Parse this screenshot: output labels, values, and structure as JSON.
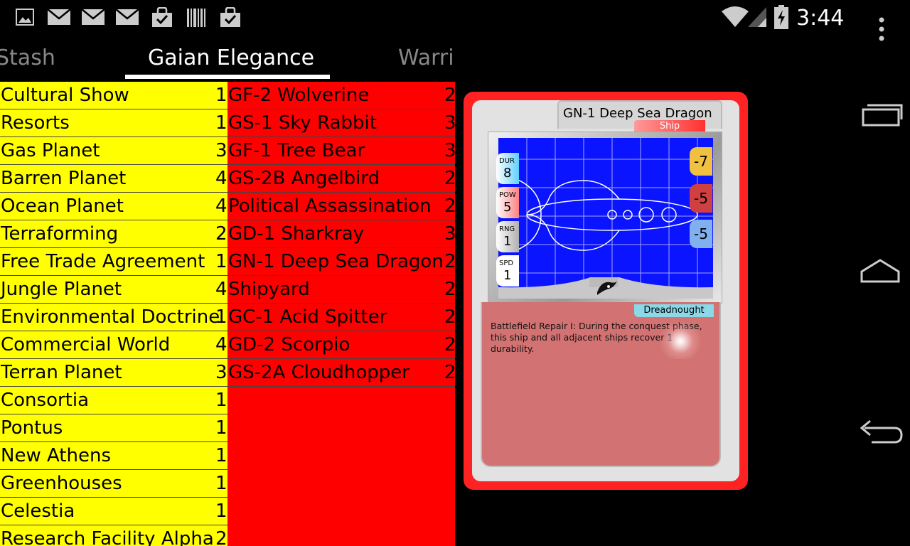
{
  "status_bar": {
    "time": "3:44",
    "notification_icons": [
      "image-icon",
      "mail-icon",
      "mail-icon",
      "mail-icon",
      "shopping-bag-icon",
      "barcode-icon",
      "shopping-bag-icon"
    ],
    "system_icons": [
      "wifi-icon",
      "signal-icon",
      "battery-charging-icon"
    ]
  },
  "tabs": [
    {
      "label": "Stash"
    },
    {
      "label": "Gaian Elegance",
      "selected": true
    },
    {
      "label": "Warrio"
    }
  ],
  "yellow_list": [
    {
      "name": "Cultural Show",
      "qty": "1"
    },
    {
      "name": "Resorts",
      "qty": "1"
    },
    {
      "name": "Gas Planet",
      "qty": "3"
    },
    {
      "name": "Barren Planet",
      "qty": "4"
    },
    {
      "name": "Ocean Planet",
      "qty": "4"
    },
    {
      "name": "Terraforming",
      "qty": "2"
    },
    {
      "name": "Free Trade Agreement",
      "qty": "1"
    },
    {
      "name": "Jungle Planet",
      "qty": "4"
    },
    {
      "name": "Environmental Doctrine",
      "qty": "1"
    },
    {
      "name": "Commercial World",
      "qty": "4"
    },
    {
      "name": "Terran Planet",
      "qty": "3"
    },
    {
      "name": "Consortia",
      "qty": "1"
    },
    {
      "name": "Pontus",
      "qty": "1"
    },
    {
      "name": "New Athens",
      "qty": "1"
    },
    {
      "name": "Greenhouses",
      "qty": "1"
    },
    {
      "name": "Celestia",
      "qty": "1"
    },
    {
      "name": "Research Facility Alpha",
      "qty": "2"
    }
  ],
  "red_list": [
    {
      "name": "GF-2 Wolverine",
      "qty": "2"
    },
    {
      "name": "GS-1 Sky Rabbit",
      "qty": "3"
    },
    {
      "name": "GF-1 Tree Bear",
      "qty": "3"
    },
    {
      "name": "GS-2B Angelbird",
      "qty": "2"
    },
    {
      "name": "Political Assassination",
      "qty": "2"
    },
    {
      "name": "GD-1 Sharkray",
      "qty": "3"
    },
    {
      "name": "GN-1 Deep Sea Dragon",
      "qty": "2"
    },
    {
      "name": "Shipyard",
      "qty": "2"
    },
    {
      "name": "GC-1 Acid Spitter",
      "qty": "2"
    },
    {
      "name": "GD-2 Scorpio",
      "qty": "2"
    },
    {
      "name": "GS-2A Cloudhopper",
      "qty": "2"
    }
  ],
  "card": {
    "title": "GN-1 Deep Sea Dragon",
    "type": "Ship",
    "subtype": "Dreadnought",
    "ability": "Battlefield Repair I: During the conquest phase, this ship and all adjacent ships recover 1 durability.",
    "stats": [
      {
        "label": "DUR",
        "value": "8",
        "color": "#5fd0ff"
      },
      {
        "label": "POW",
        "value": "5",
        "color": "#ff8080"
      },
      {
        "label": "RNG",
        "value": "1",
        "color": "#b0b0b0"
      },
      {
        "label": "SPD",
        "value": "1",
        "color": "#ffffff"
      }
    ],
    "modifiers": [
      {
        "value": "-7",
        "color": "#f0c040"
      },
      {
        "value": "-5",
        "color": "#d04040"
      },
      {
        "value": "-5",
        "color": "#80b0f0"
      }
    ],
    "frame_color": "#ff2222",
    "art_color": "#0a14ff",
    "text_area_color": "#d27272"
  },
  "nav_bar": {
    "buttons": [
      "recent-apps-icon",
      "home-icon",
      "back-icon"
    ],
    "overflow": "overflow-menu-icon"
  }
}
